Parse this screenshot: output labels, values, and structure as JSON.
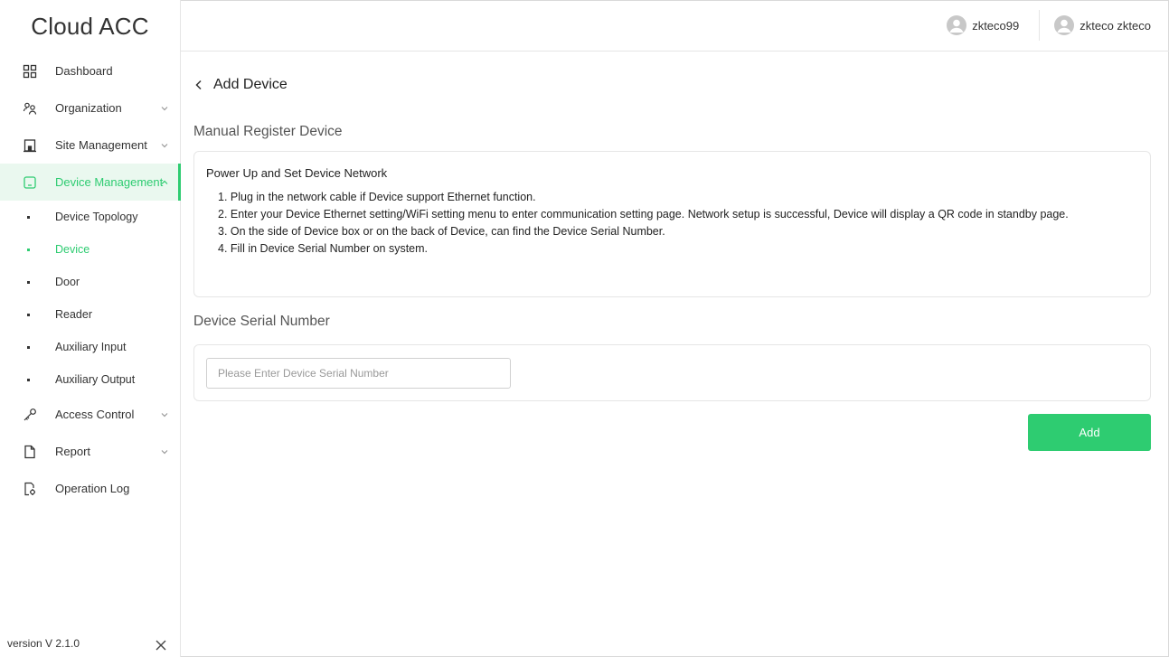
{
  "app": {
    "title": "Cloud ACC",
    "version": "version V 2.1.0",
    "accent": "#2ecc71"
  },
  "sidebar": {
    "items": [
      {
        "label": "Dashboard",
        "icon": "dashboard-icon"
      },
      {
        "label": "Organization",
        "icon": "organization-icon",
        "expandable": true
      },
      {
        "label": "Site Management",
        "icon": "building-icon",
        "expandable": true
      },
      {
        "label": "Device Management",
        "icon": "device-icon",
        "expandable": true,
        "expanded": true,
        "active": true
      },
      {
        "label": "Access Control",
        "icon": "key-icon",
        "expandable": true
      },
      {
        "label": "Report",
        "icon": "document-icon",
        "expandable": true
      },
      {
        "label": "Operation Log",
        "icon": "log-icon"
      }
    ],
    "device_subitems": [
      {
        "label": "Device Topology"
      },
      {
        "label": "Device",
        "active": true
      },
      {
        "label": "Door"
      },
      {
        "label": "Reader"
      },
      {
        "label": "Auxiliary Input"
      },
      {
        "label": "Auxiliary Output"
      }
    ]
  },
  "header": {
    "users": [
      {
        "name": "zkteco99"
      },
      {
        "name": "zkteco zkteco"
      }
    ]
  },
  "main": {
    "back_label": "Add Device",
    "manual_title": "Manual Register Device",
    "instructions": {
      "title": "Power Up and Set Device Network",
      "steps": [
        "1. Plug in the network cable if Device support Ethernet function.",
        "2. Enter your Device Ethernet setting/WiFi setting menu to enter communication setting page. Network setup is successful, Device will display a QR code in standby page.",
        "3. On the side of Device box or on the back of Device, can find the Device Serial Number.",
        "4. Fill in Device Serial Number on system."
      ]
    },
    "serial_title": "Device Serial Number",
    "serial_input": {
      "value": "",
      "placeholder": "Please Enter Device Serial Number"
    },
    "add_button": "Add"
  }
}
